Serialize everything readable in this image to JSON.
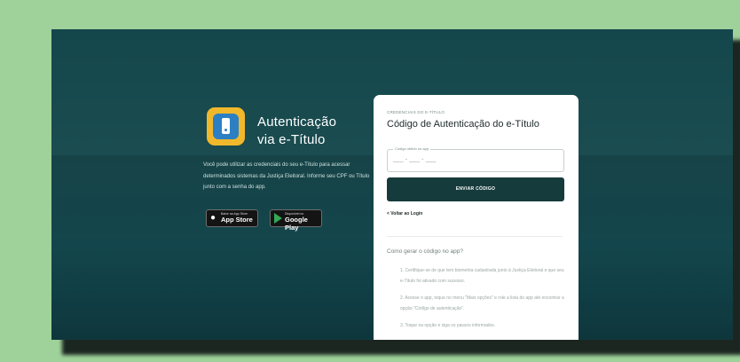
{
  "brand": {
    "title_line1": "Autenticação",
    "title_line2": "via e-Título",
    "logo_icon": "e-titulo-app-icon"
  },
  "intro": {
    "description": "Você pode utilizar as credenciais do seu e-Título para acessar determinados sistemas da Justiça Eleitoral. Informe seu CPF ou Título junto com a senha do app."
  },
  "stores": {
    "apple": {
      "small": "Baixe na App Store",
      "label": "App Store",
      "icon": "apple-icon"
    },
    "google": {
      "small": "Disponível no",
      "label": "Google Play",
      "icon": "google-play-icon"
    }
  },
  "card": {
    "overline": "CREDENCIAIS DO E-TÍTULO",
    "title": "Código de Autenticação do e-Título",
    "field_label": "Código obtido no app",
    "field_value": "___ - ___ - ___",
    "submit_label": "ENVIAR CÓDIGO",
    "back_label": "< Voltar ao Login"
  },
  "faq": {
    "question": "Como gerar o código no app?",
    "steps": [
      "1. Certifique-se de que tem biometria cadastrada junto à Justiça Eleitoral e que seu e-Título foi ativado com sucesso.",
      "2. Acesse o app, toque no menu \"Mais opções\" e role a lista do app até encontrar a opção \"Código de autenticação\".",
      "3. Toque na opção e siga os passos informados."
    ]
  },
  "colors": {
    "page_bg": "#9fd19a",
    "screen_bg": "#14474b",
    "button_bg": "#163b3c",
    "logo_yellow": "#f1b82b",
    "logo_blue": "#2d7fc4"
  }
}
